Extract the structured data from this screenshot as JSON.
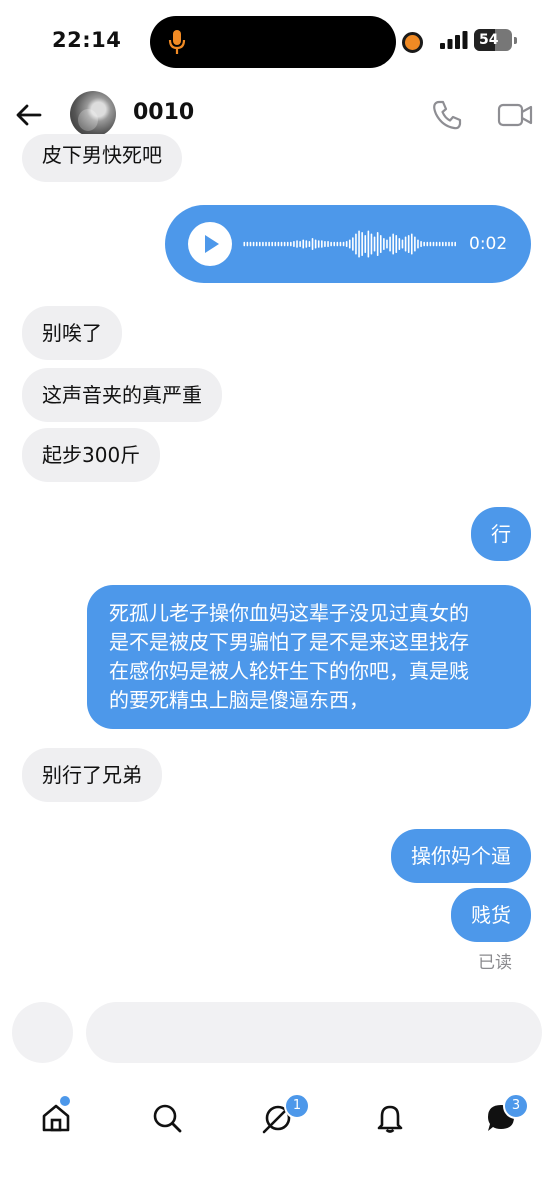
{
  "status_bar": {
    "time": "22:14",
    "battery": "54",
    "battery_fraction": 0.54,
    "icons": [
      "microphone-icon",
      "recording-dot-icon",
      "signal-icon",
      "battery-icon"
    ],
    "accent_orange": "#f08a24"
  },
  "header": {
    "contact_name": "0010",
    "icons": [
      "back-arrow-icon",
      "avatar",
      "phone-icon",
      "video-camera-icon"
    ]
  },
  "messages": [
    {
      "direction": "in",
      "text": "皮下男快死吧"
    },
    {
      "direction": "out",
      "type": "voice",
      "duration": "0:02"
    },
    {
      "direction": "in",
      "text": "别唉了"
    },
    {
      "direction": "in",
      "text": "这声音夹的真严重"
    },
    {
      "direction": "in",
      "text": "起步300斤"
    },
    {
      "direction": "out",
      "text": "行"
    },
    {
      "direction": "out",
      "lines": [
        "死孤儿老子操你血妈这辈子没见过真女的",
        "是不是被皮下男骗怕了是不是来这里找存",
        "在感你妈是被人轮奸生下的你吧，真是贱",
        "的要死精虫上脑是傻逼东西，"
      ]
    },
    {
      "direction": "in",
      "text": "别行了兄弟"
    },
    {
      "direction": "out",
      "text": "操你妈个逼"
    },
    {
      "direction": "out",
      "text": "贱货"
    }
  ],
  "read_receipt": "已读",
  "composer": {
    "placeholder": ""
  },
  "tab_bar": {
    "tabs": [
      "home-icon",
      "search-icon",
      "spaces-icon",
      "bell-icon",
      "messages-icon"
    ],
    "spaces_badge": "1",
    "messages_badge": "3"
  },
  "colors": {
    "bubble_out": "#4d98ea",
    "bubble_in": "#efeff1",
    "muted_text": "#8a8a8e"
  }
}
